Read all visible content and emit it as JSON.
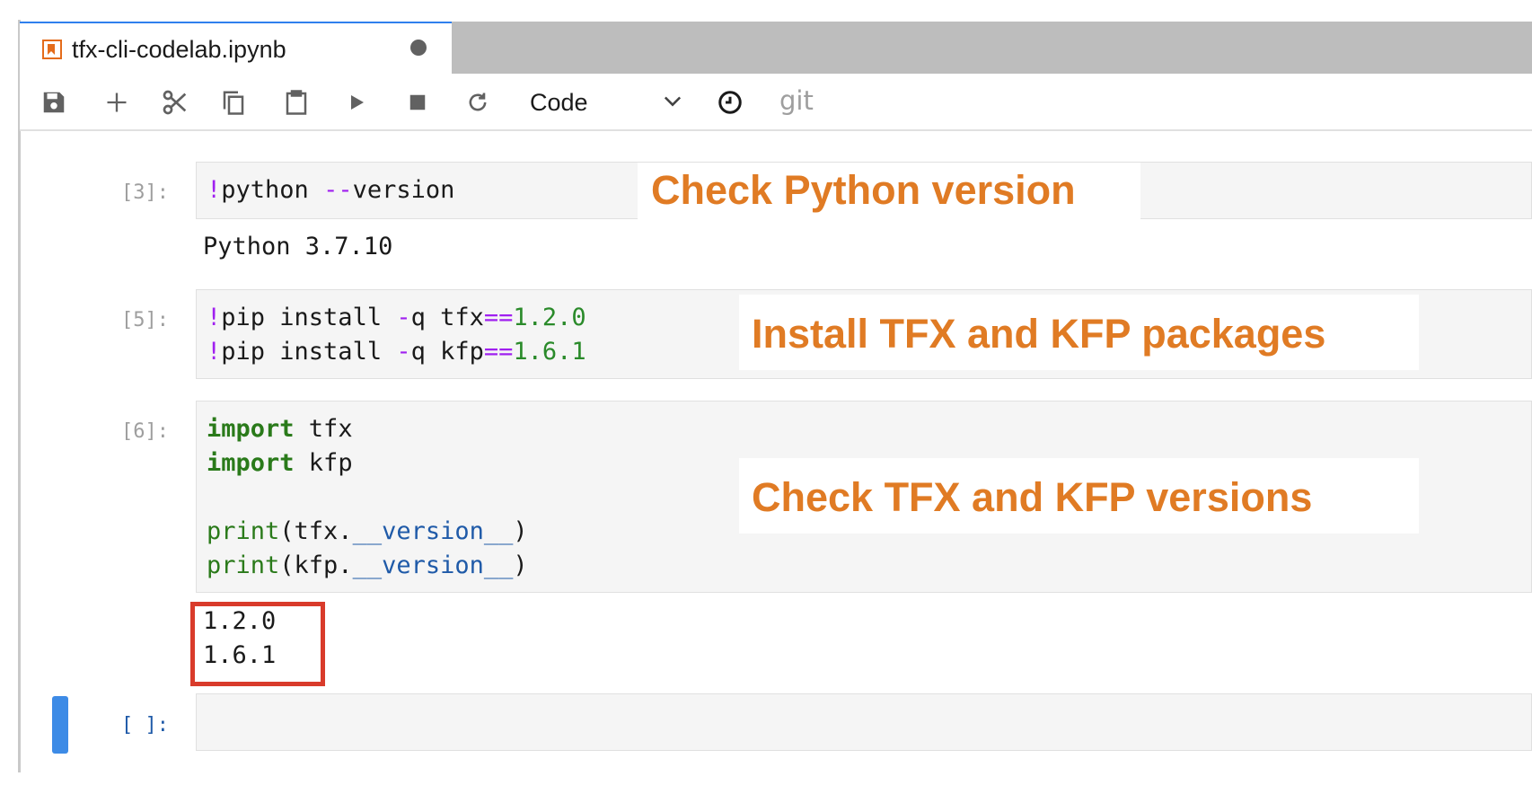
{
  "tab": {
    "title": "tfx-cli-codelab.ipynb",
    "icon": "notebook-icon",
    "modified_indicator": "unsaved-dot"
  },
  "toolbar": {
    "buttons": [
      "save-icon",
      "add-icon",
      "cut-icon",
      "copy-icon",
      "paste-icon",
      "run-icon",
      "stop-icon",
      "restart-icon"
    ],
    "cell_type": "Code",
    "git_label": "git"
  },
  "cells": [
    {
      "prompt": "[3]:",
      "code": [
        "!python --version"
      ],
      "output": [
        "Python 3.7.10"
      ]
    },
    {
      "prompt": "[5]:",
      "code": [
        "!pip install -q tfx==1.2.0",
        "!pip install -q kfp==1.6.1"
      ],
      "output": []
    },
    {
      "prompt": "[6]:",
      "code": [
        "import tfx",
        "import kfp",
        "",
        "print(tfx.__version__)",
        "print(kfp.__version__)"
      ],
      "output": [
        "1.2.0",
        "1.6.1"
      ]
    },
    {
      "prompt": "[ ]:",
      "code": [],
      "output": []
    }
  ],
  "annotations": {
    "python_version": "Check Python version",
    "install": "Install TFX and KFP packages",
    "versions": "Check TFX and KFP versions"
  },
  "colors": {
    "annotation": "#e07b24",
    "highlight_box": "#d93b2b",
    "active_cell": "#3d8be6",
    "tab_icon": "#e46c1b"
  }
}
